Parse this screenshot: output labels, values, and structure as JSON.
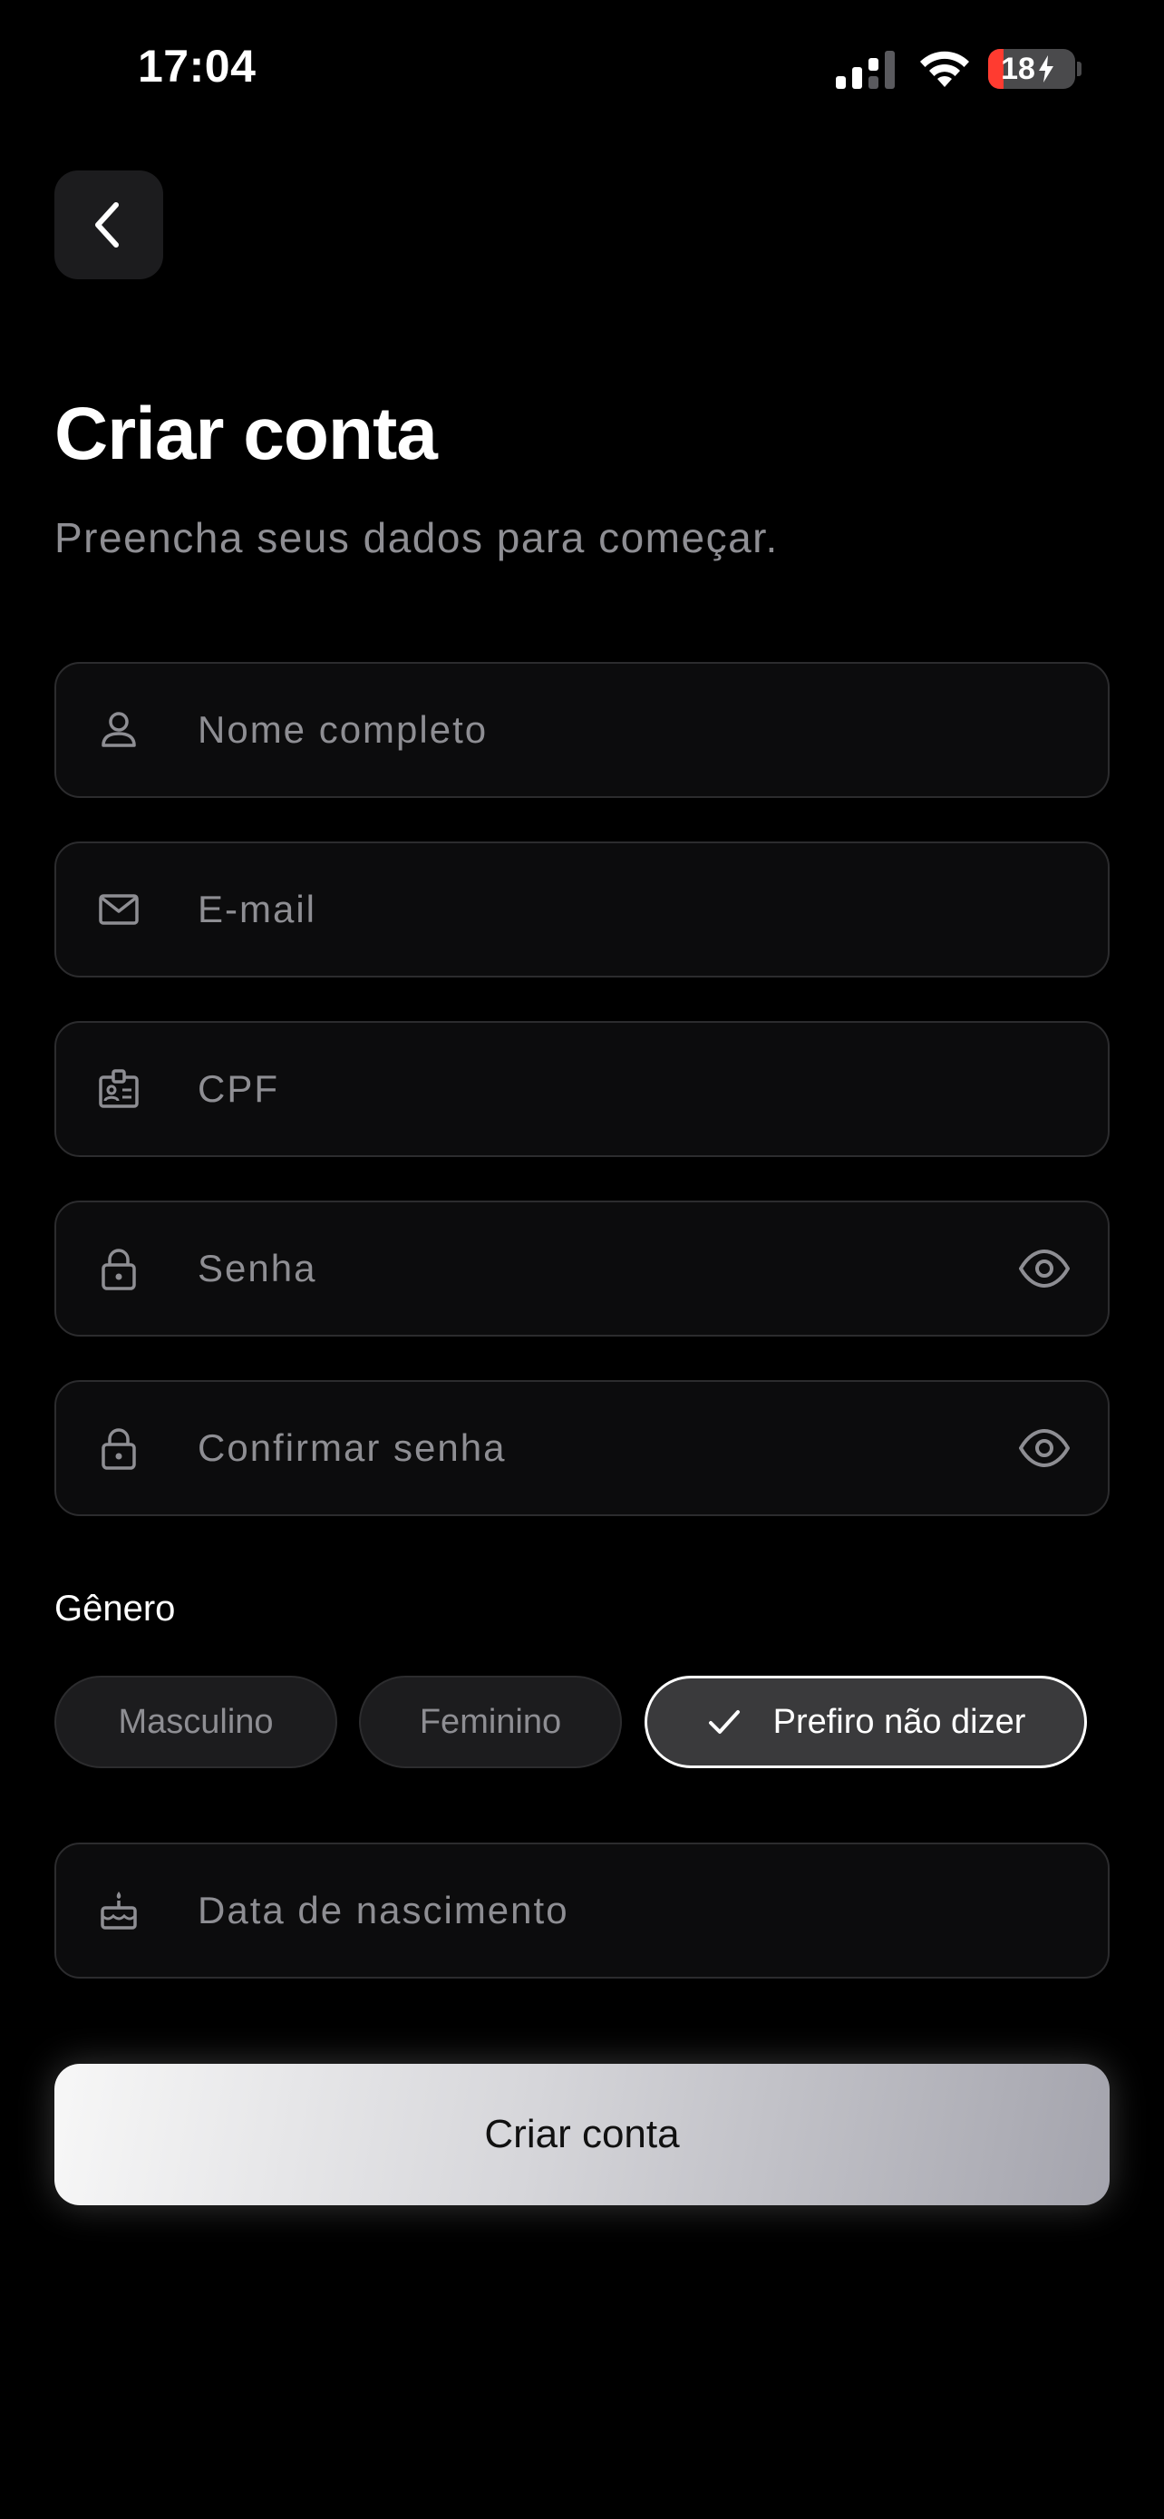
{
  "status_bar": {
    "time": "17:04",
    "battery_text": "18",
    "battery_level": 0.18
  },
  "header": {
    "back_icon": "chevron-left-icon",
    "title": "Criar conta",
    "subtitle": "Preencha seus dados para começar."
  },
  "form": {
    "name": {
      "placeholder": "Nome completo",
      "value": "",
      "icon": "user-icon"
    },
    "email": {
      "placeholder": "E-mail",
      "value": "",
      "icon": "mail-icon"
    },
    "cpf": {
      "placeholder": "CPF",
      "value": "",
      "icon": "id-card-icon"
    },
    "password": {
      "placeholder": "Senha",
      "value": "",
      "icon": "lock-icon",
      "toggle_icon": "eye-icon"
    },
    "confirm_password": {
      "placeholder": "Confirmar senha",
      "value": "",
      "icon": "lock-icon",
      "toggle_icon": "eye-icon"
    },
    "gender": {
      "label": "Gênero",
      "options": [
        "Masculino",
        "Feminino",
        "Prefiro não dizer"
      ],
      "selected": "Prefiro não dizer"
    },
    "birth_date": {
      "placeholder": "Data de nascimento",
      "value": "",
      "icon": "cake-icon"
    }
  },
  "submit_label": "Criar conta",
  "colors": {
    "background": "#000000",
    "field_border": "#2c2c2e",
    "placeholder": "#8e8e93",
    "battery_low": "#ff3b30"
  }
}
